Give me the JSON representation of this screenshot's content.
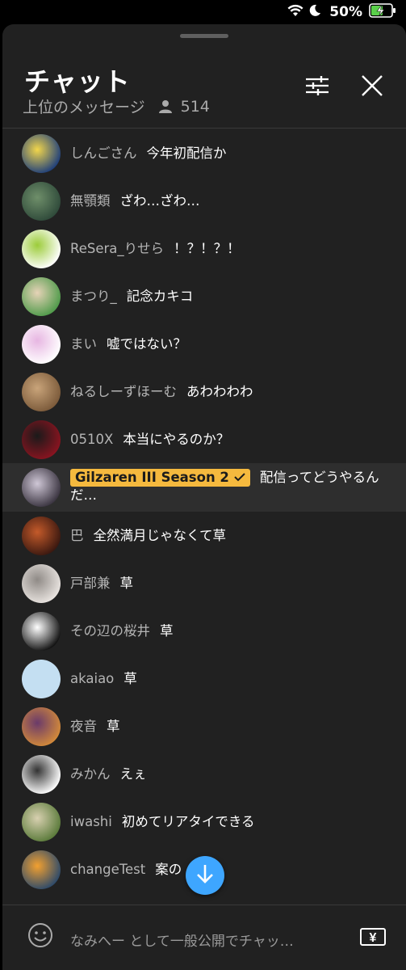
{
  "status_bar": {
    "battery_percent": "50%",
    "icons": [
      "wifi-icon",
      "moon-icon",
      "battery-charging-icon"
    ]
  },
  "header": {
    "title": "チャット",
    "mode": "上位のメッセージ",
    "viewer_count": "514",
    "icons": [
      "filter-sliders-icon",
      "close-icon"
    ]
  },
  "messages": [
    {
      "author": "しんごさん",
      "text": "今年初配信か",
      "avatar_colors": [
        "#1f3f7a",
        "#f2d64b"
      ]
    },
    {
      "author": "無顎類",
      "text": "ざわ…ざわ…",
      "avatar_colors": [
        "#2f4a3a",
        "#6f8f6a"
      ]
    },
    {
      "author": "ReSera_りせら",
      "text": "！？！？！",
      "avatar_colors": [
        "#ffffff",
        "#9ccc3a"
      ]
    },
    {
      "author": "まつり_",
      "text": "記念カキコ",
      "avatar_colors": [
        "#4f9a4a",
        "#e6d3b7"
      ]
    },
    {
      "author": "まい",
      "text": "嘘ではない？",
      "avatar_colors": [
        "#ffffff",
        "#e7b6e2"
      ]
    },
    {
      "author": "ねるしーずほーむ",
      "text": "あわわわわ",
      "avatar_colors": [
        "#7b5a3a",
        "#c9a47a"
      ]
    },
    {
      "author": "0510X",
      "text": "本当にやるのか？",
      "avatar_colors": [
        "#8a1420",
        "#1a1a1a"
      ]
    },
    {
      "author": "Gilzaren III Season 2",
      "text": "配信ってどうやるんだ…",
      "is_owner": true,
      "avatar_colors": [
        "#3a3440",
        "#cfc7d6"
      ]
    },
    {
      "author": "巴",
      "text": "全然満月じゃなくて草",
      "avatar_colors": [
        "#3a1810",
        "#c45a2a"
      ]
    },
    {
      "author": "戸部兼",
      "text": "草",
      "avatar_colors": [
        "#e9e4e0",
        "#8f8a86"
      ]
    },
    {
      "author": "その辺の桜井",
      "text": "草",
      "avatar_colors": [
        "#111111",
        "#ffffff"
      ]
    },
    {
      "author": "akaiao",
      "text": "草",
      "avatar_colors": [
        "#c4dff2",
        "#c4dff2"
      ]
    },
    {
      "author": "夜音",
      "text": "草",
      "avatar_colors": [
        "#d38a3a",
        "#6a3a6a"
      ]
    },
    {
      "author": "みかん",
      "text": "えぇ",
      "avatar_colors": [
        "#ffffff",
        "#333333"
      ]
    },
    {
      "author": "iwashi",
      "text": "初めてリアタイできる",
      "avatar_colors": [
        "#5a7a3a",
        "#d8d0b0"
      ]
    },
    {
      "author": "changeTest",
      "text": "案の",
      "avatar_colors": [
        "#2d4a6a",
        "#f2a030"
      ]
    }
  ],
  "input": {
    "placeholder": "なみへー として一般公開でチャッ…",
    "superchat_label": "¥"
  },
  "colors": {
    "panel_bg": "#212121",
    "owner_badge": "#f5b93e",
    "scroll_button": "#3ea6ff"
  }
}
